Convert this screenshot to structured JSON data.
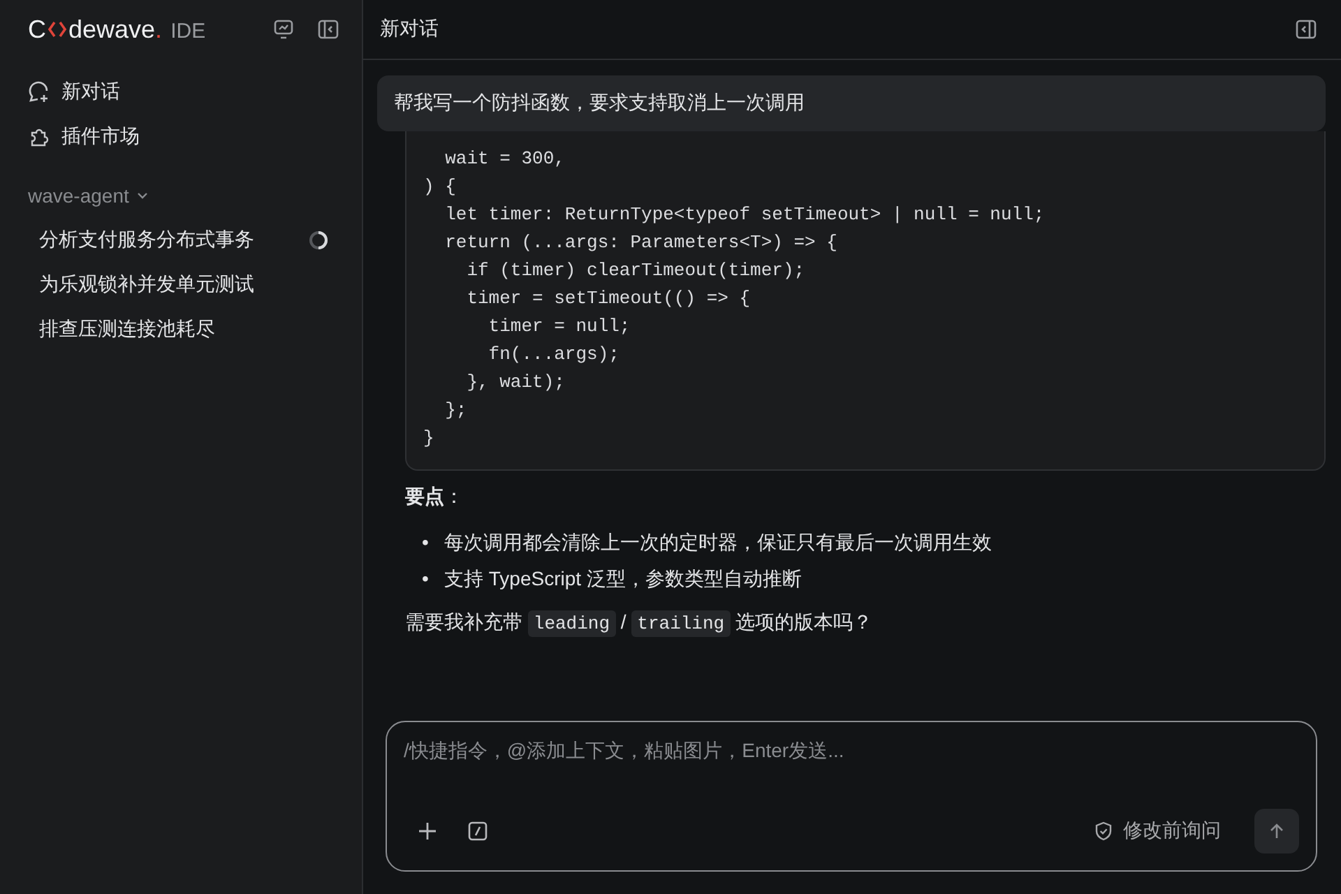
{
  "sidebar": {
    "logo": {
      "start": "C",
      "end": "dewave",
      "dot": ".",
      "suffix": "IDE"
    },
    "nav": [
      {
        "label": "新对话",
        "kind": "chat"
      },
      {
        "label": "插件市场",
        "kind": "plugin"
      }
    ],
    "group": {
      "label": "wave-agent",
      "expanded": true,
      "sessions": [
        {
          "title": "分析支付服务分布式事务",
          "running": true
        },
        {
          "title": "为乐观锁补并发单元测试",
          "running": false
        },
        {
          "title": "排查压测连接池耗尽",
          "running": false
        }
      ]
    }
  },
  "header": {
    "title": "新对话"
  },
  "user_message": "帮我写一个防抖函数，要求支持取消上一次调用",
  "code_lines": [
    "  wait = 300,",
    ") {",
    "  let timer: ReturnType<typeof setTimeout> | null = null;",
    "  return (...args: Parameters<T>) => {",
    "    if (timer) clearTimeout(timer);",
    "    timer = setTimeout(() => {",
    "      timer = null;",
    "      fn(...args);",
    "    }, wait);",
    "  };",
    "}"
  ],
  "points_title": "要点",
  "points_colon": "：",
  "points": [
    {
      "bullet": "•",
      "text": "每次调用都会清除上一次的定时器，保证只有最后一次调用生效"
    },
    {
      "bullet": "•",
      "text": "支持 TypeScript 泛型，参数类型自动推断"
    }
  ],
  "question": {
    "before": "需要我补充带",
    "code1": "leading",
    "sep": "/",
    "code2": "trailing",
    "after": "选项的版本吗？"
  },
  "composer": {
    "placeholder": "/快捷指令，@添加上下文，粘贴图片，Enter发送...",
    "mode": "修改前询问"
  }
}
